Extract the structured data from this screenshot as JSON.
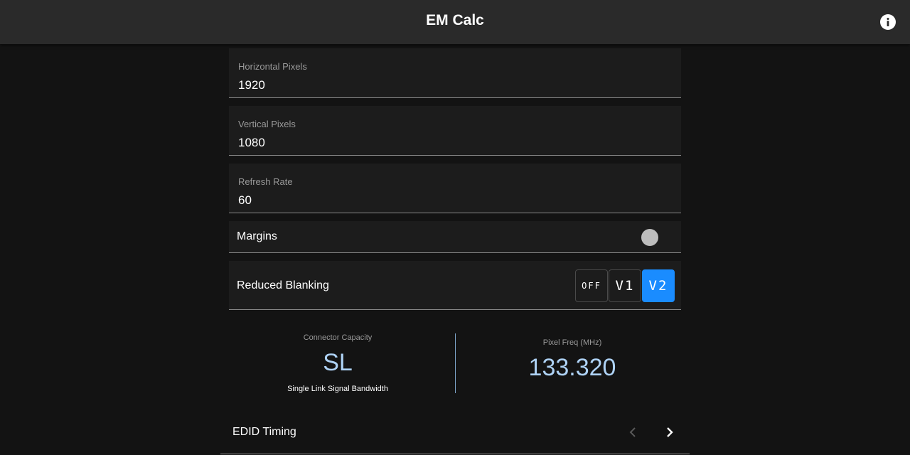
{
  "app": {
    "title": "EM Calc"
  },
  "fields": {
    "horizontal": {
      "label": "Horizontal Pixels",
      "value": "1920"
    },
    "vertical": {
      "label": "Vertical Pixels",
      "value": "1080"
    },
    "refresh": {
      "label": "Refresh Rate",
      "value": "60"
    }
  },
  "margins": {
    "label": "Margins",
    "enabled": false
  },
  "reduced_blanking": {
    "label": "Reduced Blanking",
    "options": [
      "OFF",
      "V1",
      "V2"
    ],
    "selected": "V2"
  },
  "connector": {
    "label": "Connector Capacity",
    "value": "SL",
    "description": "Single Link Signal Bandwidth"
  },
  "pixel_freq": {
    "label": "Pixel Freq (MHz)",
    "value": "133.320"
  },
  "edid": {
    "label": "EDID Timing"
  },
  "colors": {
    "accent": "#1a8cff",
    "value_text": "#aed2f5",
    "background": "#131313",
    "appbar": "#2a2a2a"
  },
  "icons": {
    "info": "info-icon",
    "prev": "chevron-left-icon",
    "next": "chevron-right-icon"
  }
}
